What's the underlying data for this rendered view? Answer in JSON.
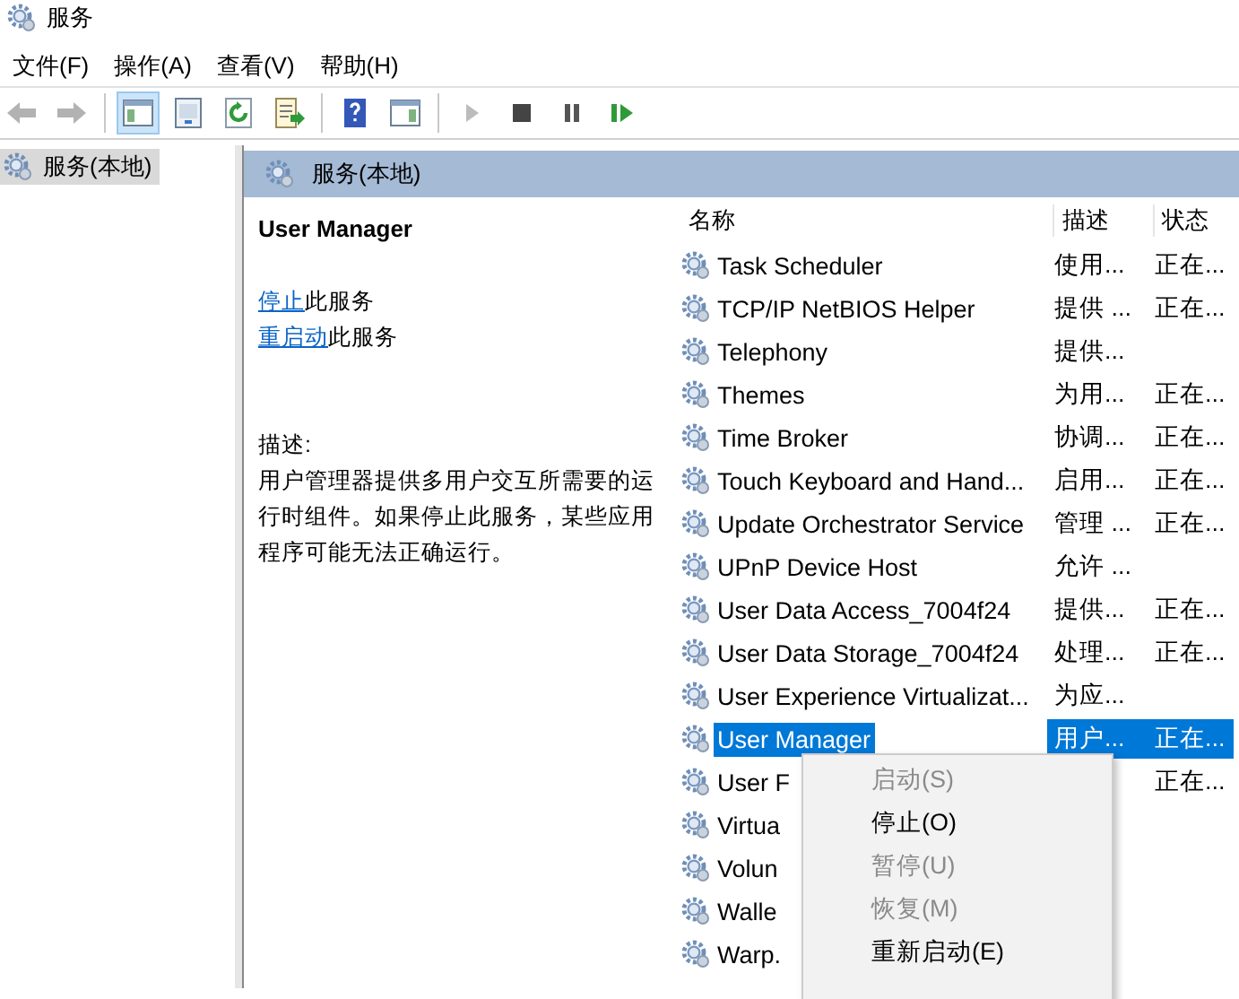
{
  "window": {
    "title": "服务"
  },
  "menu": [
    "文件(F)",
    "操作(A)",
    "查看(V)",
    "帮助(H)"
  ],
  "toolbar": [
    [
      {
        "kind": "back",
        "disabled": true,
        "selected": false
      },
      {
        "kind": "forward",
        "disabled": true,
        "selected": false
      }
    ],
    [
      {
        "kind": "tree",
        "disabled": false,
        "selected": true
      },
      {
        "kind": "props",
        "disabled": false,
        "selected": false
      },
      {
        "kind": "refresh",
        "disabled": false,
        "selected": false
      },
      {
        "kind": "export",
        "disabled": false,
        "selected": false
      }
    ],
    [
      {
        "kind": "help",
        "disabled": false,
        "selected": false
      },
      {
        "kind": "pane",
        "disabled": false,
        "selected": false
      }
    ],
    [
      {
        "kind": "play",
        "disabled": true,
        "selected": false
      },
      {
        "kind": "stop",
        "disabled": false,
        "selected": false
      },
      {
        "kind": "pause",
        "disabled": false,
        "selected": false
      },
      {
        "kind": "resume",
        "disabled": false,
        "selected": false
      }
    ]
  ],
  "tree": [
    {
      "label": "服务(本地)",
      "selected": true
    }
  ],
  "panel_header": "服务(本地)",
  "details": {
    "title": "User Manager",
    "actions": [
      {
        "link": "停止",
        "text": "此服务"
      },
      {
        "link": "重启动",
        "text": "此服务"
      }
    ],
    "description_label": "描述:",
    "description": "用户管理器提供多用户交互所需要的运行时组件。如果停止此服务，某些应用程序可能无法正确运行。"
  },
  "table": {
    "columns": [
      "名称",
      "描述",
      "状态"
    ],
    "rows": [
      {
        "name": "Task Scheduler",
        "description": "使用...",
        "status": "正在...",
        "selected": false
      },
      {
        "name": "TCP/IP NetBIOS Helper",
        "description": "提供 ...",
        "status": "正在...",
        "selected": false
      },
      {
        "name": "Telephony",
        "description": "提供...",
        "status": "",
        "selected": false
      },
      {
        "name": "Themes",
        "description": "为用...",
        "status": "正在...",
        "selected": false
      },
      {
        "name": "Time Broker",
        "description": "协调...",
        "status": "正在...",
        "selected": false
      },
      {
        "name": "Touch Keyboard and Hand...",
        "description": "启用...",
        "status": "正在...",
        "selected": false
      },
      {
        "name": "Update Orchestrator Service",
        "description": "管理 ...",
        "status": "正在...",
        "selected": false
      },
      {
        "name": "UPnP Device Host",
        "description": "允许 ...",
        "status": "",
        "selected": false
      },
      {
        "name": "User Data Access_7004f24",
        "description": "提供...",
        "status": "正在...",
        "selected": false
      },
      {
        "name": "User Data Storage_7004f24",
        "description": "处理...",
        "status": "正在...",
        "selected": false
      },
      {
        "name": "User Experience Virtualizat...",
        "description": "为应...",
        "status": "",
        "selected": false
      },
      {
        "name": "User Manager",
        "description": "用户...",
        "status": "正在...",
        "selected": true
      },
      {
        "name": "User F",
        "description": "",
        "status": "正在...",
        "selected": false
      },
      {
        "name": "Virtua",
        "description": "",
        "status": "",
        "selected": false
      },
      {
        "name": "Volun",
        "description": "",
        "status": "",
        "selected": false
      },
      {
        "name": "Walle",
        "description": "",
        "status": "",
        "selected": false
      },
      {
        "name": "Warp.",
        "description": "",
        "status": "",
        "selected": false
      }
    ]
  },
  "context_menu": [
    {
      "label": "启动(S)",
      "disabled": true
    },
    {
      "label": "停止(O)",
      "disabled": false
    },
    {
      "label": "暂停(U)",
      "disabled": true
    },
    {
      "label": "恢复(M)",
      "disabled": true
    },
    {
      "label": "重新启动(E)",
      "disabled": false
    }
  ]
}
